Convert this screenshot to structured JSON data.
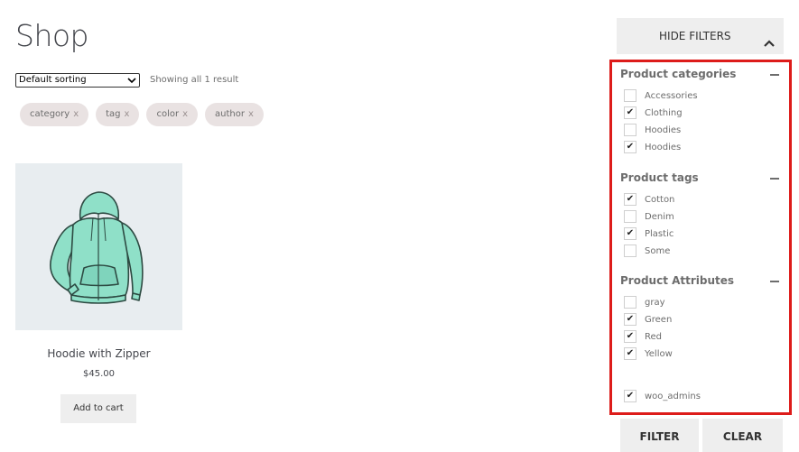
{
  "page": {
    "title": "Shop"
  },
  "toolbar": {
    "sort_value": "Default sorting",
    "result_count": "Showing all 1 result"
  },
  "chips": [
    {
      "label": "category",
      "remove": "x"
    },
    {
      "label": "tag",
      "remove": "x"
    },
    {
      "label": "color",
      "remove": "x"
    },
    {
      "label": "author",
      "remove": "x"
    }
  ],
  "product": {
    "name": "Hoodie with Zipper",
    "price": "$45.00",
    "add_to_cart": "Add to cart"
  },
  "filters": {
    "hide_label": "HIDE FILTERS",
    "groups": [
      {
        "title": "Product categories",
        "options": [
          {
            "label": "Accessories",
            "checked": false
          },
          {
            "label": "Clothing",
            "checked": true
          },
          {
            "label": "Hoodies",
            "checked": false
          },
          {
            "label": "Hoodies",
            "checked": true
          }
        ]
      },
      {
        "title": "Product tags",
        "options": [
          {
            "label": "Cotton",
            "checked": true
          },
          {
            "label": "Denim",
            "checked": false
          },
          {
            "label": "Plastic",
            "checked": true
          },
          {
            "label": "Some",
            "checked": false
          }
        ]
      },
      {
        "title": "Product Attributes",
        "options": [
          {
            "label": "gray",
            "checked": false
          },
          {
            "label": "Green",
            "checked": true
          },
          {
            "label": "Red",
            "checked": true
          },
          {
            "label": "Yellow",
            "checked": true
          }
        ]
      }
    ],
    "extra_option": {
      "label": "woo_admins",
      "checked": true
    },
    "filter_button": "FILTER",
    "clear_button": "CLEAR"
  },
  "colors": {
    "highlight_border": "#dd1c1a",
    "button_bg": "#eeeeee",
    "chip_bg": "#e9e2e2",
    "hoodie": "#8fe0c8"
  },
  "icons": {
    "hide_filters": "chevron-up-icon",
    "group_toggle": "minus-icon",
    "select": "chevron-down-icon",
    "check": "checkmark-icon"
  }
}
